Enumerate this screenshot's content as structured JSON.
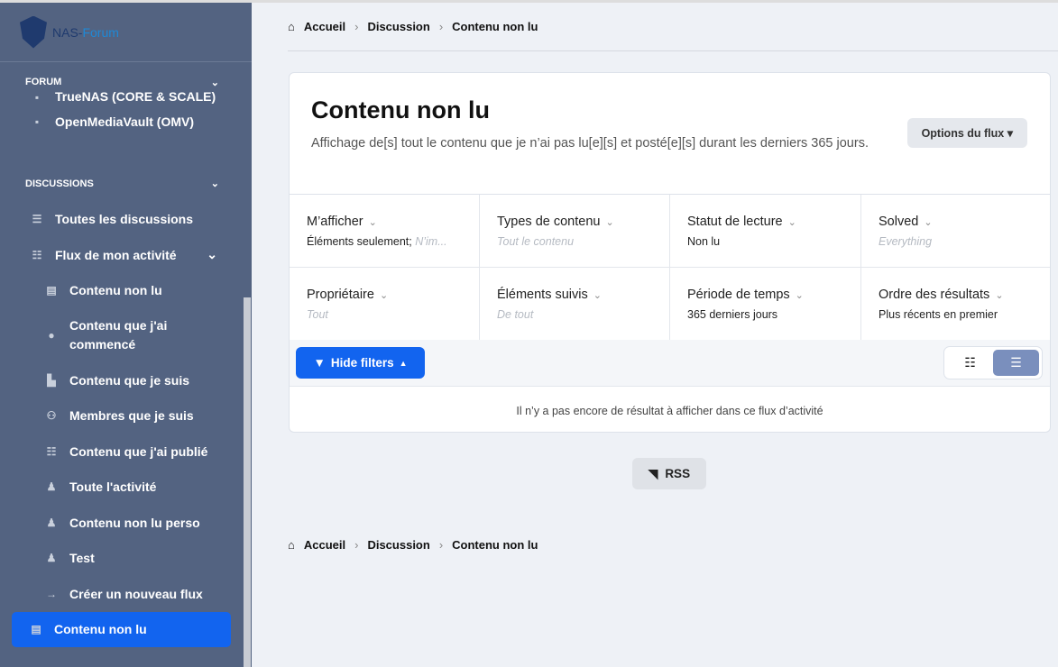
{
  "logo": {
    "a": "NAS-",
    "b": "Forum"
  },
  "sidebar": {
    "forum_header": "FORUM",
    "forum_items": [
      "TrueNAS (CORE & SCALE)",
      "OpenMediaVault (OMV)"
    ],
    "discussions_header": "DISCUSSIONS",
    "items": [
      {
        "label": "Toutes les discussions",
        "icon": "list-icon",
        "sub": false
      },
      {
        "label": "Flux de mon activité",
        "icon": "checklist-icon",
        "sub": false
      },
      {
        "label": "Contenu non lu",
        "icon": "newspaper-icon",
        "sub": true
      },
      {
        "label": "Contenu que j'ai commencé",
        "icon": "user-circle-icon",
        "sub": true
      },
      {
        "label": "Contenu que je suis",
        "icon": "file-clock-icon",
        "sub": true
      },
      {
        "label": "Membres que je suis",
        "icon": "users-icon",
        "sub": true
      },
      {
        "label": "Contenu que j'ai publié",
        "icon": "checklist-icon",
        "sub": true
      },
      {
        "label": "Toute l'activité",
        "icon": "user-clock-icon",
        "sub": true
      },
      {
        "label": "Contenu non lu perso",
        "icon": "user-clock-icon",
        "sub": true
      },
      {
        "label": "Test",
        "icon": "user-clock-icon",
        "sub": true
      },
      {
        "label": "Créer un nouveau flux",
        "icon": "arrow-right-icon",
        "sub": true
      }
    ],
    "active": "Contenu non lu"
  },
  "breadcrumb": [
    "Accueil",
    "Discussion",
    "Contenu non lu"
  ],
  "page": {
    "title": "Contenu non lu",
    "description": "Affichage de[s] tout le contenu que je n’ai pas lu[e][s] et posté[e][s] durant les derniers 365 jours.",
    "options": "Options du flux"
  },
  "filters": [
    {
      "title": "M’afficher",
      "value": "Éléments seulement;",
      "extra": "N’im...",
      "placeholder": false
    },
    {
      "title": "Types de contenu",
      "value": "Tout le contenu",
      "placeholder": true
    },
    {
      "title": "Statut de lecture",
      "value": "Non lu",
      "placeholder": false
    },
    {
      "title": "Solved",
      "value": "Everything",
      "placeholder": true
    },
    {
      "title": "Propriétaire",
      "value": "Tout",
      "placeholder": true
    },
    {
      "title": "Éléments suivis",
      "value": "De tout",
      "placeholder": true
    },
    {
      "title": "Période de temps",
      "value": "365 derniers jours",
      "placeholder": false
    },
    {
      "title": "Ordre des résultats",
      "value": "Plus récents en premier",
      "placeholder": false
    }
  ],
  "hide_filters": "Hide filters",
  "empty": "Il n’y a pas encore de résultat à afficher dans ce flux d’activité",
  "rss": "RSS"
}
